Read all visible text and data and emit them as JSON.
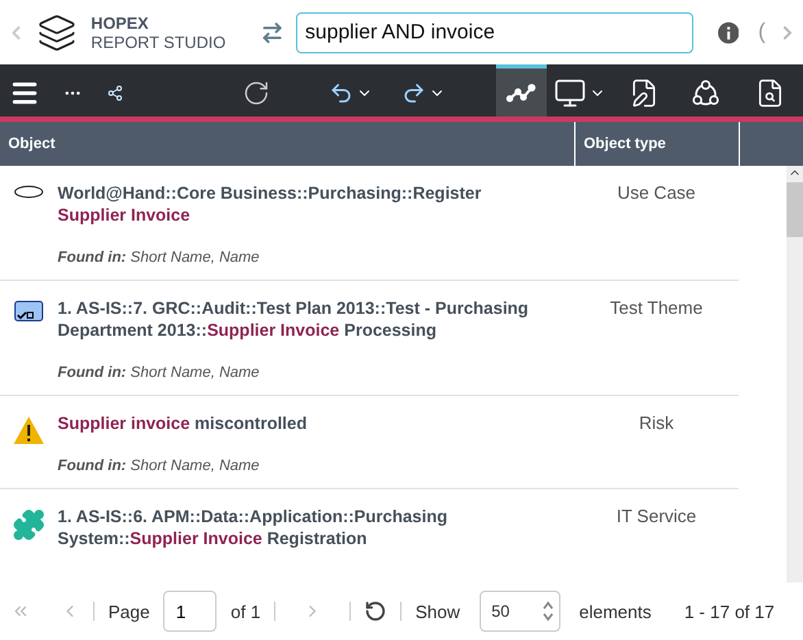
{
  "header": {
    "product": "HOPEX",
    "subtitle": "REPORT STUDIO",
    "search": {
      "value": "supplier AND invoice"
    },
    "left_nav_disabled": true,
    "right_paren": "("
  },
  "toolbar": [
    {
      "kind": "menu",
      "selected": false
    },
    {
      "kind": "more",
      "selected": false
    },
    {
      "kind": "share",
      "selected": false
    },
    {
      "kind": "refresh",
      "selected": false
    },
    {
      "kind": "undo",
      "selected": false
    },
    {
      "kind": "redo",
      "selected": false
    },
    {
      "kind": "graph",
      "selected": true
    },
    {
      "kind": "monitor",
      "selected": false
    },
    {
      "kind": "report",
      "selected": false
    },
    {
      "kind": "network",
      "selected": false
    },
    {
      "kind": "doc-search",
      "selected": false
    }
  ],
  "table": {
    "columns": [
      "Object",
      "Object type"
    ],
    "rows": [
      {
        "kind": "use-case",
        "title": [
          {
            "text": "World@Hand::Core Business::Purchasing::Register ",
            "highlight": false
          },
          {
            "text": "Supplier Invoice",
            "highlight": true
          }
        ],
        "found_in": "**Found in:** Short Name, Name",
        "type": "Use Case"
      },
      {
        "kind": "test-theme",
        "title": [
          {
            "text": "1. AS-IS::7. GRC::Audit::Test Plan 2013::Test - Purchasing Department 2013::",
            "highlight": false
          },
          {
            "text": "Supplier Invoice",
            "highlight": true
          },
          {
            "text": " Processing",
            "highlight": false
          }
        ],
        "found_in": "**Found in:** Short Name, Name",
        "type": "Test Theme"
      },
      {
        "kind": "risk",
        "title": [
          {
            "text": "Supplier invoice",
            "highlight": true
          },
          {
            "text": " miscontrolled",
            "highlight": false
          }
        ],
        "found_in": "**Found in:** Short Name, Name",
        "type": "Risk"
      },
      {
        "kind": "it-service",
        "title": [
          {
            "text": "1. AS-IS::6. APM::Data::Application::Purchasing System::",
            "highlight": false
          },
          {
            "text": "Supplier Invoice",
            "highlight": true
          },
          {
            "text": " Registration",
            "highlight": false
          }
        ],
        "type": "IT Service"
      }
    ]
  },
  "pager": {
    "first_disabled": true,
    "prev_disabled": true,
    "next_disabled": true,
    "page_label": "Page",
    "page": "1",
    "of": "of 1",
    "show": "Show",
    "page_size": "50",
    "elements": "elements",
    "range": "1 - 17 of 17"
  }
}
